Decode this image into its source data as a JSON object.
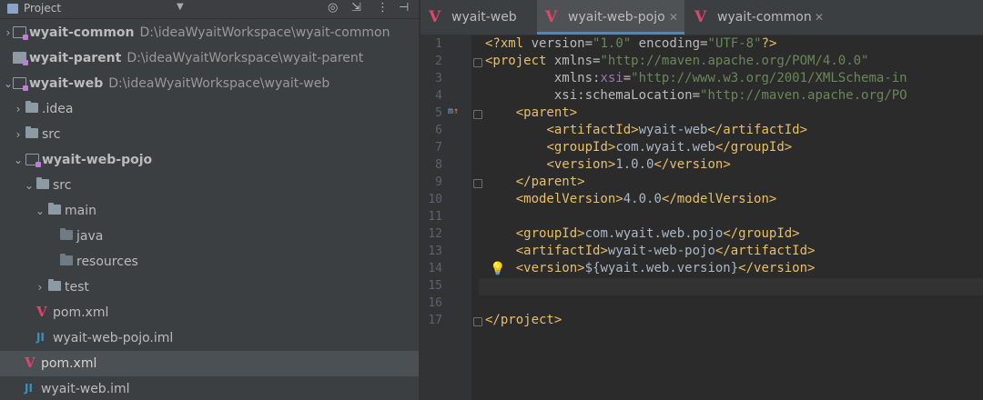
{
  "project_panel": {
    "title": "Project",
    "tree": [
      {
        "label": "wyait-common",
        "path": "D:\\ideaWyaitWorkspace\\wyait-common",
        "type": "module"
      },
      {
        "label": "wyait-parent",
        "path": "D:\\ideaWyaitWorkspace\\wyait-parent",
        "type": "module"
      },
      {
        "label": "wyait-web",
        "path": "D:\\ideaWyaitWorkspace\\wyait-web",
        "type": "module"
      },
      {
        "label": ".idea",
        "type": "folder"
      },
      {
        "label": "src",
        "type": "folder"
      },
      {
        "label": "wyait-web-pojo",
        "type": "module"
      },
      {
        "label": "src",
        "type": "folder"
      },
      {
        "label": "main",
        "type": "folder"
      },
      {
        "label": "java",
        "type": "folder"
      },
      {
        "label": "resources",
        "type": "folder"
      },
      {
        "label": "test",
        "type": "folder"
      },
      {
        "label": "pom.xml",
        "type": "maven"
      },
      {
        "label": "wyait-web-pojo.iml",
        "type": "iml"
      },
      {
        "label": "pom.xml",
        "type": "maven"
      },
      {
        "label": "wyait-web.iml",
        "type": "iml"
      }
    ]
  },
  "editor": {
    "tabs": [
      {
        "label": "wyait-web",
        "active": false
      },
      {
        "label": "wyait-web-pojo",
        "active": true
      },
      {
        "label": "wyait-common",
        "active": false
      }
    ],
    "line_numbers": [
      "1",
      "2",
      "3",
      "4",
      "5",
      "6",
      "7",
      "8",
      "9",
      "10",
      "11",
      "12",
      "13",
      "14",
      "15",
      "16",
      "17"
    ],
    "lines": [
      "<?xml version=\"1.0\" encoding=\"UTF-8\"?>",
      "<project xmlns=\"http://maven.apache.org/POM/4.0.0\"",
      "         xmlns:xsi=\"http://www.w3.org/2001/XMLSchema-in",
      "         xsi:schemaLocation=\"http://maven.apache.org/PO",
      "    <parent>",
      "        <artifactId>wyait-web</artifactId>",
      "        <groupId>com.wyait.web</groupId>",
      "        <version>1.0.0</version>",
      "    </parent>",
      "    <modelVersion>4.0.0</modelVersion>",
      "",
      "    <groupId>com.wyait.web.pojo</groupId>",
      "    <artifactId>wyait-web-pojo</artifactId>",
      "    <version>${wyait.web.version}</version>",
      "",
      "",
      "</project>"
    ]
  },
  "colors": {
    "tag": "#e8bf6a",
    "attr_value": "#6a8759",
    "namespace": "#9876aa",
    "text": "#a9b7c6",
    "maven_icon": "#e0466b",
    "selection": "#0d293e"
  }
}
